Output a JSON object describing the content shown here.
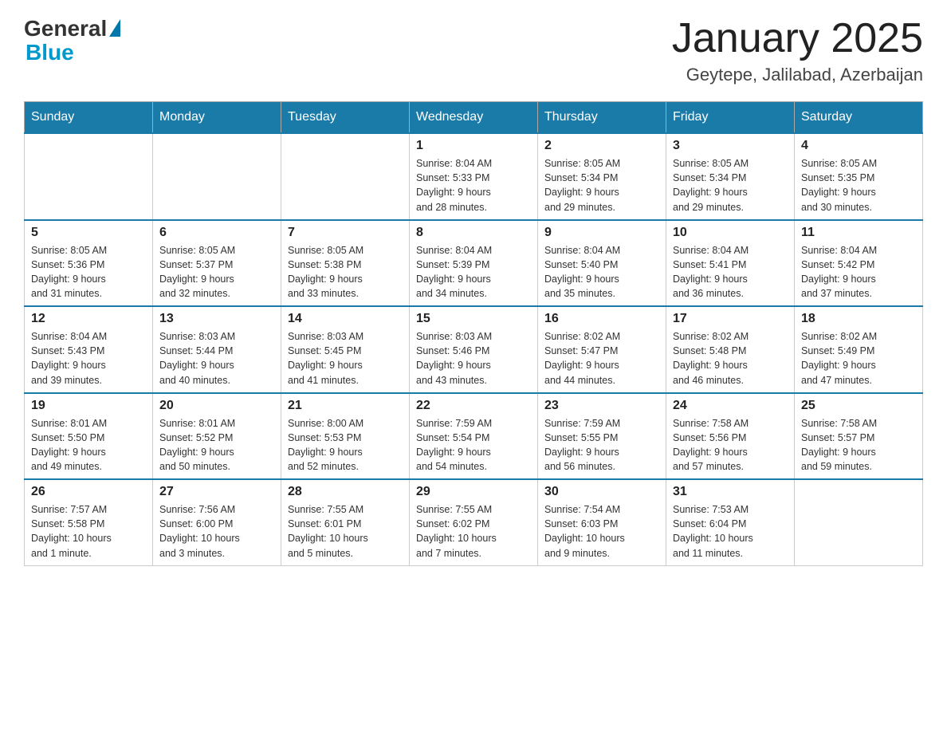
{
  "header": {
    "logo_general": "General",
    "logo_blue": "Blue",
    "title": "January 2025",
    "location": "Geytepe, Jalilabad, Azerbaijan"
  },
  "days_of_week": [
    "Sunday",
    "Monday",
    "Tuesday",
    "Wednesday",
    "Thursday",
    "Friday",
    "Saturday"
  ],
  "weeks": [
    [
      {
        "day": "",
        "info": ""
      },
      {
        "day": "",
        "info": ""
      },
      {
        "day": "",
        "info": ""
      },
      {
        "day": "1",
        "info": "Sunrise: 8:04 AM\nSunset: 5:33 PM\nDaylight: 9 hours\nand 28 minutes."
      },
      {
        "day": "2",
        "info": "Sunrise: 8:05 AM\nSunset: 5:34 PM\nDaylight: 9 hours\nand 29 minutes."
      },
      {
        "day": "3",
        "info": "Sunrise: 8:05 AM\nSunset: 5:34 PM\nDaylight: 9 hours\nand 29 minutes."
      },
      {
        "day": "4",
        "info": "Sunrise: 8:05 AM\nSunset: 5:35 PM\nDaylight: 9 hours\nand 30 minutes."
      }
    ],
    [
      {
        "day": "5",
        "info": "Sunrise: 8:05 AM\nSunset: 5:36 PM\nDaylight: 9 hours\nand 31 minutes."
      },
      {
        "day": "6",
        "info": "Sunrise: 8:05 AM\nSunset: 5:37 PM\nDaylight: 9 hours\nand 32 minutes."
      },
      {
        "day": "7",
        "info": "Sunrise: 8:05 AM\nSunset: 5:38 PM\nDaylight: 9 hours\nand 33 minutes."
      },
      {
        "day": "8",
        "info": "Sunrise: 8:04 AM\nSunset: 5:39 PM\nDaylight: 9 hours\nand 34 minutes."
      },
      {
        "day": "9",
        "info": "Sunrise: 8:04 AM\nSunset: 5:40 PM\nDaylight: 9 hours\nand 35 minutes."
      },
      {
        "day": "10",
        "info": "Sunrise: 8:04 AM\nSunset: 5:41 PM\nDaylight: 9 hours\nand 36 minutes."
      },
      {
        "day": "11",
        "info": "Sunrise: 8:04 AM\nSunset: 5:42 PM\nDaylight: 9 hours\nand 37 minutes."
      }
    ],
    [
      {
        "day": "12",
        "info": "Sunrise: 8:04 AM\nSunset: 5:43 PM\nDaylight: 9 hours\nand 39 minutes."
      },
      {
        "day": "13",
        "info": "Sunrise: 8:03 AM\nSunset: 5:44 PM\nDaylight: 9 hours\nand 40 minutes."
      },
      {
        "day": "14",
        "info": "Sunrise: 8:03 AM\nSunset: 5:45 PM\nDaylight: 9 hours\nand 41 minutes."
      },
      {
        "day": "15",
        "info": "Sunrise: 8:03 AM\nSunset: 5:46 PM\nDaylight: 9 hours\nand 43 minutes."
      },
      {
        "day": "16",
        "info": "Sunrise: 8:02 AM\nSunset: 5:47 PM\nDaylight: 9 hours\nand 44 minutes."
      },
      {
        "day": "17",
        "info": "Sunrise: 8:02 AM\nSunset: 5:48 PM\nDaylight: 9 hours\nand 46 minutes."
      },
      {
        "day": "18",
        "info": "Sunrise: 8:02 AM\nSunset: 5:49 PM\nDaylight: 9 hours\nand 47 minutes."
      }
    ],
    [
      {
        "day": "19",
        "info": "Sunrise: 8:01 AM\nSunset: 5:50 PM\nDaylight: 9 hours\nand 49 minutes."
      },
      {
        "day": "20",
        "info": "Sunrise: 8:01 AM\nSunset: 5:52 PM\nDaylight: 9 hours\nand 50 minutes."
      },
      {
        "day": "21",
        "info": "Sunrise: 8:00 AM\nSunset: 5:53 PM\nDaylight: 9 hours\nand 52 minutes."
      },
      {
        "day": "22",
        "info": "Sunrise: 7:59 AM\nSunset: 5:54 PM\nDaylight: 9 hours\nand 54 minutes."
      },
      {
        "day": "23",
        "info": "Sunrise: 7:59 AM\nSunset: 5:55 PM\nDaylight: 9 hours\nand 56 minutes."
      },
      {
        "day": "24",
        "info": "Sunrise: 7:58 AM\nSunset: 5:56 PM\nDaylight: 9 hours\nand 57 minutes."
      },
      {
        "day": "25",
        "info": "Sunrise: 7:58 AM\nSunset: 5:57 PM\nDaylight: 9 hours\nand 59 minutes."
      }
    ],
    [
      {
        "day": "26",
        "info": "Sunrise: 7:57 AM\nSunset: 5:58 PM\nDaylight: 10 hours\nand 1 minute."
      },
      {
        "day": "27",
        "info": "Sunrise: 7:56 AM\nSunset: 6:00 PM\nDaylight: 10 hours\nand 3 minutes."
      },
      {
        "day": "28",
        "info": "Sunrise: 7:55 AM\nSunset: 6:01 PM\nDaylight: 10 hours\nand 5 minutes."
      },
      {
        "day": "29",
        "info": "Sunrise: 7:55 AM\nSunset: 6:02 PM\nDaylight: 10 hours\nand 7 minutes."
      },
      {
        "day": "30",
        "info": "Sunrise: 7:54 AM\nSunset: 6:03 PM\nDaylight: 10 hours\nand 9 minutes."
      },
      {
        "day": "31",
        "info": "Sunrise: 7:53 AM\nSunset: 6:04 PM\nDaylight: 10 hours\nand 11 minutes."
      },
      {
        "day": "",
        "info": ""
      }
    ]
  ]
}
